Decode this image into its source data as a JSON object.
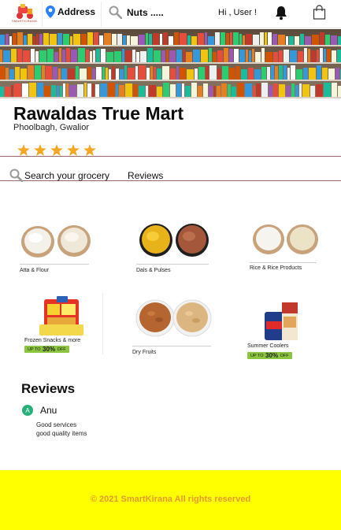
{
  "header": {
    "logo_text": "SMARTKIRANA",
    "location_label": "Address",
    "search_text": "Nuts .....",
    "greeting": "Hi , User !"
  },
  "store": {
    "name": "Rawaldas True Mart",
    "location": "Phoolbagh, Gwalior",
    "rating": 5,
    "star_color": "#f5a623"
  },
  "tabs": {
    "search_label": "Search your grocery",
    "reviews_label": "Reviews"
  },
  "categories": [
    {
      "label": "Atta & Flour"
    },
    {
      "label": "Dals & Pulses"
    },
    {
      "label": "Rice & Rice Products"
    },
    {
      "label": "Frozen Snacks & more",
      "offer": {
        "prefix": "UP TO",
        "value": "30%",
        "suffix": "OFF"
      }
    },
    {
      "label": "Dry Fruits"
    },
    {
      "label": "Summer Coolers",
      "offer": {
        "prefix": "UP TO",
        "value": "30%",
        "suffix": "OFF"
      }
    }
  ],
  "reviews": {
    "title": "Reviews",
    "items": [
      {
        "initial": "A",
        "name": "Anu",
        "lines": [
          "Good services",
          "good quality items"
        ]
      }
    ]
  },
  "footer": {
    "text": "© 2021 SmartKirana All rights reserved",
    "bg_color": "#ffff00",
    "text_color": "#e69a2e"
  },
  "colors": {
    "offer_badge": "#8cc63f",
    "avatar": "#27b07a",
    "location_pin": "#2d7ff9"
  }
}
